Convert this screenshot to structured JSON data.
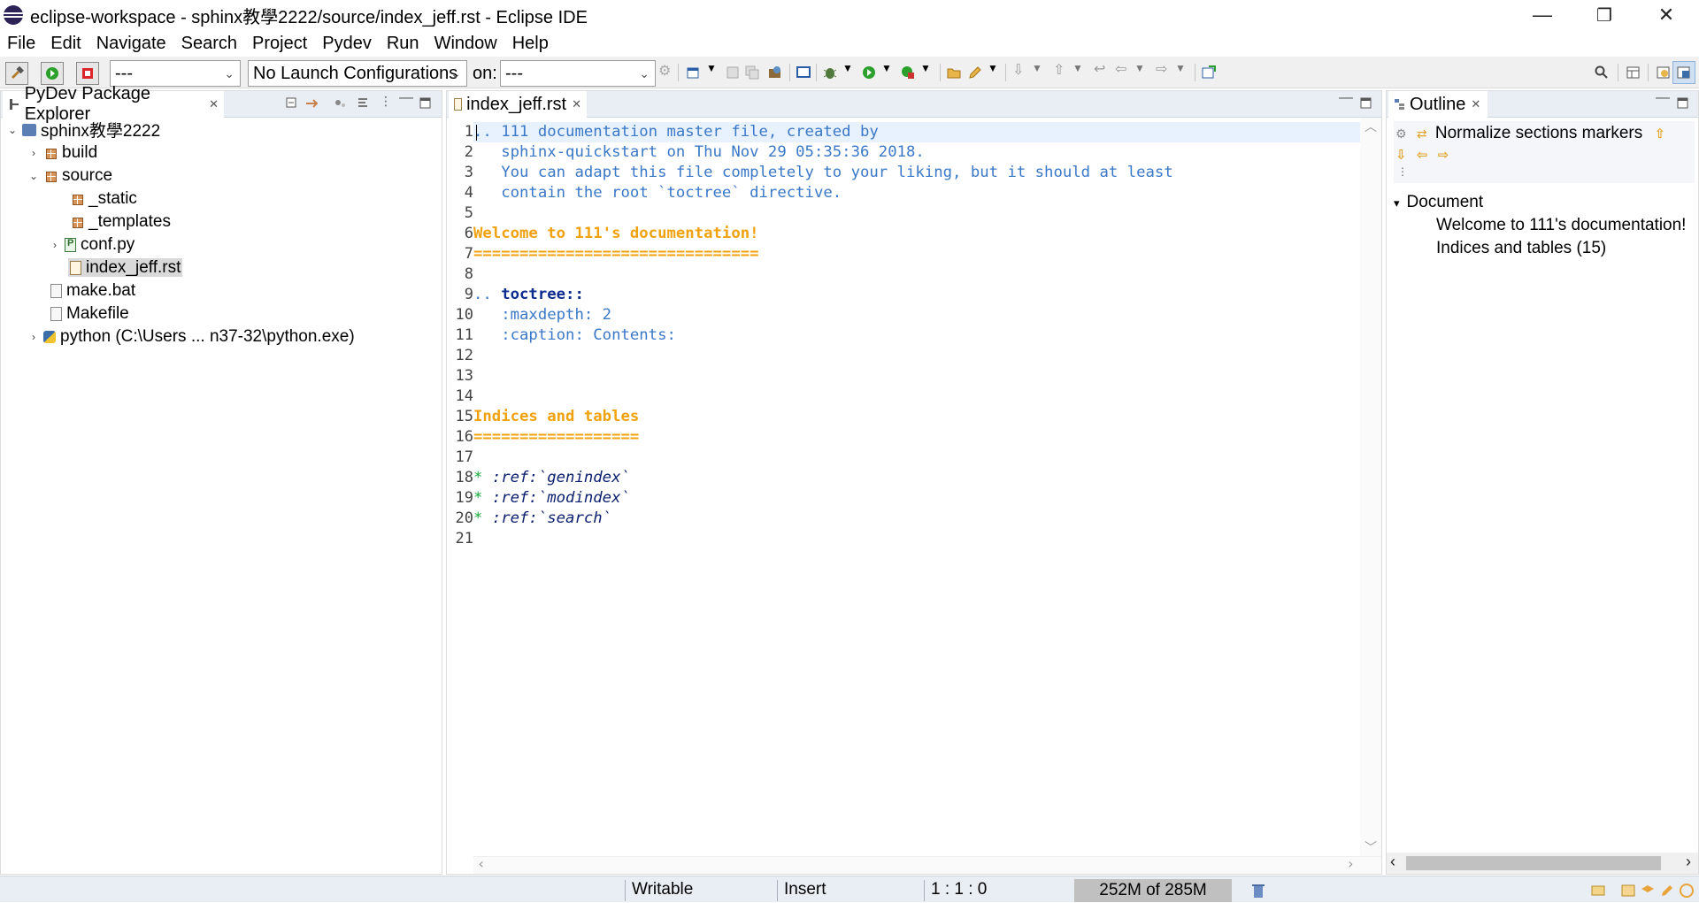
{
  "window": {
    "title": "eclipse-workspace - sphinx教學2222/source/index_jeff.rst - Eclipse IDE",
    "minimize": "—",
    "restore": "❐",
    "close": "✕"
  },
  "menu": [
    "File",
    "Edit",
    "Navigate",
    "Search",
    "Project",
    "Pydev",
    "Run",
    "Window",
    "Help"
  ],
  "toolbar": {
    "mode_combo": "---",
    "launch_combo": "No Launch Configurations",
    "on_label": "on:",
    "target_combo": "---"
  },
  "package_explorer": {
    "title": "PyDev Package Explorer",
    "tree": [
      {
        "label": "sphinx教學2222",
        "expanded": true,
        "icon": "project-icon"
      },
      {
        "label": "build",
        "expanded": false,
        "icon": "package-folder-icon"
      },
      {
        "label": "source",
        "expanded": true,
        "icon": "package-folder-icon"
      },
      {
        "label": "_static",
        "icon": "package-folder-icon"
      },
      {
        "label": "_templates",
        "icon": "package-folder-icon"
      },
      {
        "label": "conf.py",
        "expanded": false,
        "icon": "python-file-icon"
      },
      {
        "label": "index_jeff.rst",
        "selected": true,
        "icon": "rst-file-icon"
      },
      {
        "label": "make.bat",
        "icon": "file-icon"
      },
      {
        "label": "Makefile",
        "icon": "file-icon"
      },
      {
        "label": "python  (C:\\Users ... n37-32\\python.exe)",
        "expanded": false,
        "icon": "python-interpreter-icon"
      }
    ]
  },
  "editor": {
    "tab_label": "index_jeff.rst",
    "lines": [
      {
        "n": "1",
        "text": ".. 111 documentation master file, created by",
        "style": "comment"
      },
      {
        "n": "2",
        "text": "   sphinx-quickstart on Thu Nov 29 05:35:36 2018.",
        "style": "comment"
      },
      {
        "n": "3",
        "text": "   You can adapt this file completely to your liking, but it should at least",
        "style": "comment"
      },
      {
        "n": "4",
        "text": "   contain the root `toctree` directive.",
        "style": "comment"
      },
      {
        "n": "5",
        "text": "",
        "style": "plain"
      },
      {
        "n": "6",
        "text": "Welcome to 111's documentation!",
        "style": "heading"
      },
      {
        "n": "7",
        "text": "===============================",
        "style": "heading"
      },
      {
        "n": "8",
        "text": "",
        "style": "plain"
      },
      {
        "n": "9",
        "prefix": ".. ",
        "text": "toctree::",
        "style": "directive"
      },
      {
        "n": "10",
        "text": "   :maxdepth: 2",
        "style": "option"
      },
      {
        "n": "11",
        "text": "   :caption: Contents:",
        "style": "option"
      },
      {
        "n": "12",
        "text": "",
        "style": "plain"
      },
      {
        "n": "13",
        "text": "",
        "style": "plain"
      },
      {
        "n": "14",
        "text": "",
        "style": "plain"
      },
      {
        "n": "15",
        "text": "Indices and tables",
        "style": "heading"
      },
      {
        "n": "16",
        "text": "==================",
        "style": "heading"
      },
      {
        "n": "17",
        "text": "",
        "style": "plain"
      },
      {
        "n": "18",
        "prefix": "* ",
        "text": ":ref:`genindex`",
        "style": "ref"
      },
      {
        "n": "19",
        "prefix": "* ",
        "text": ":ref:`modindex`",
        "style": "ref"
      },
      {
        "n": "20",
        "prefix": "* ",
        "text": ":ref:`search`",
        "style": "ref"
      },
      {
        "n": "21",
        "text": "",
        "style": "plain"
      }
    ]
  },
  "outline": {
    "title": "Outline",
    "normalize_label": "Normalize sections markers",
    "root": "Document",
    "items": [
      "Welcome to 111's documentation!",
      "Indices and tables (15)"
    ]
  },
  "status": {
    "writable": "Writable",
    "insert_mode": "Insert",
    "position": "1 : 1 : 0",
    "heap": "252M of 285M"
  },
  "colors": {
    "comment": "#3a78c8",
    "heading": "#f0a20e",
    "directive": "#0b2b8e",
    "bullet": "#17a83a",
    "tab_bar": "#e9eef5"
  }
}
